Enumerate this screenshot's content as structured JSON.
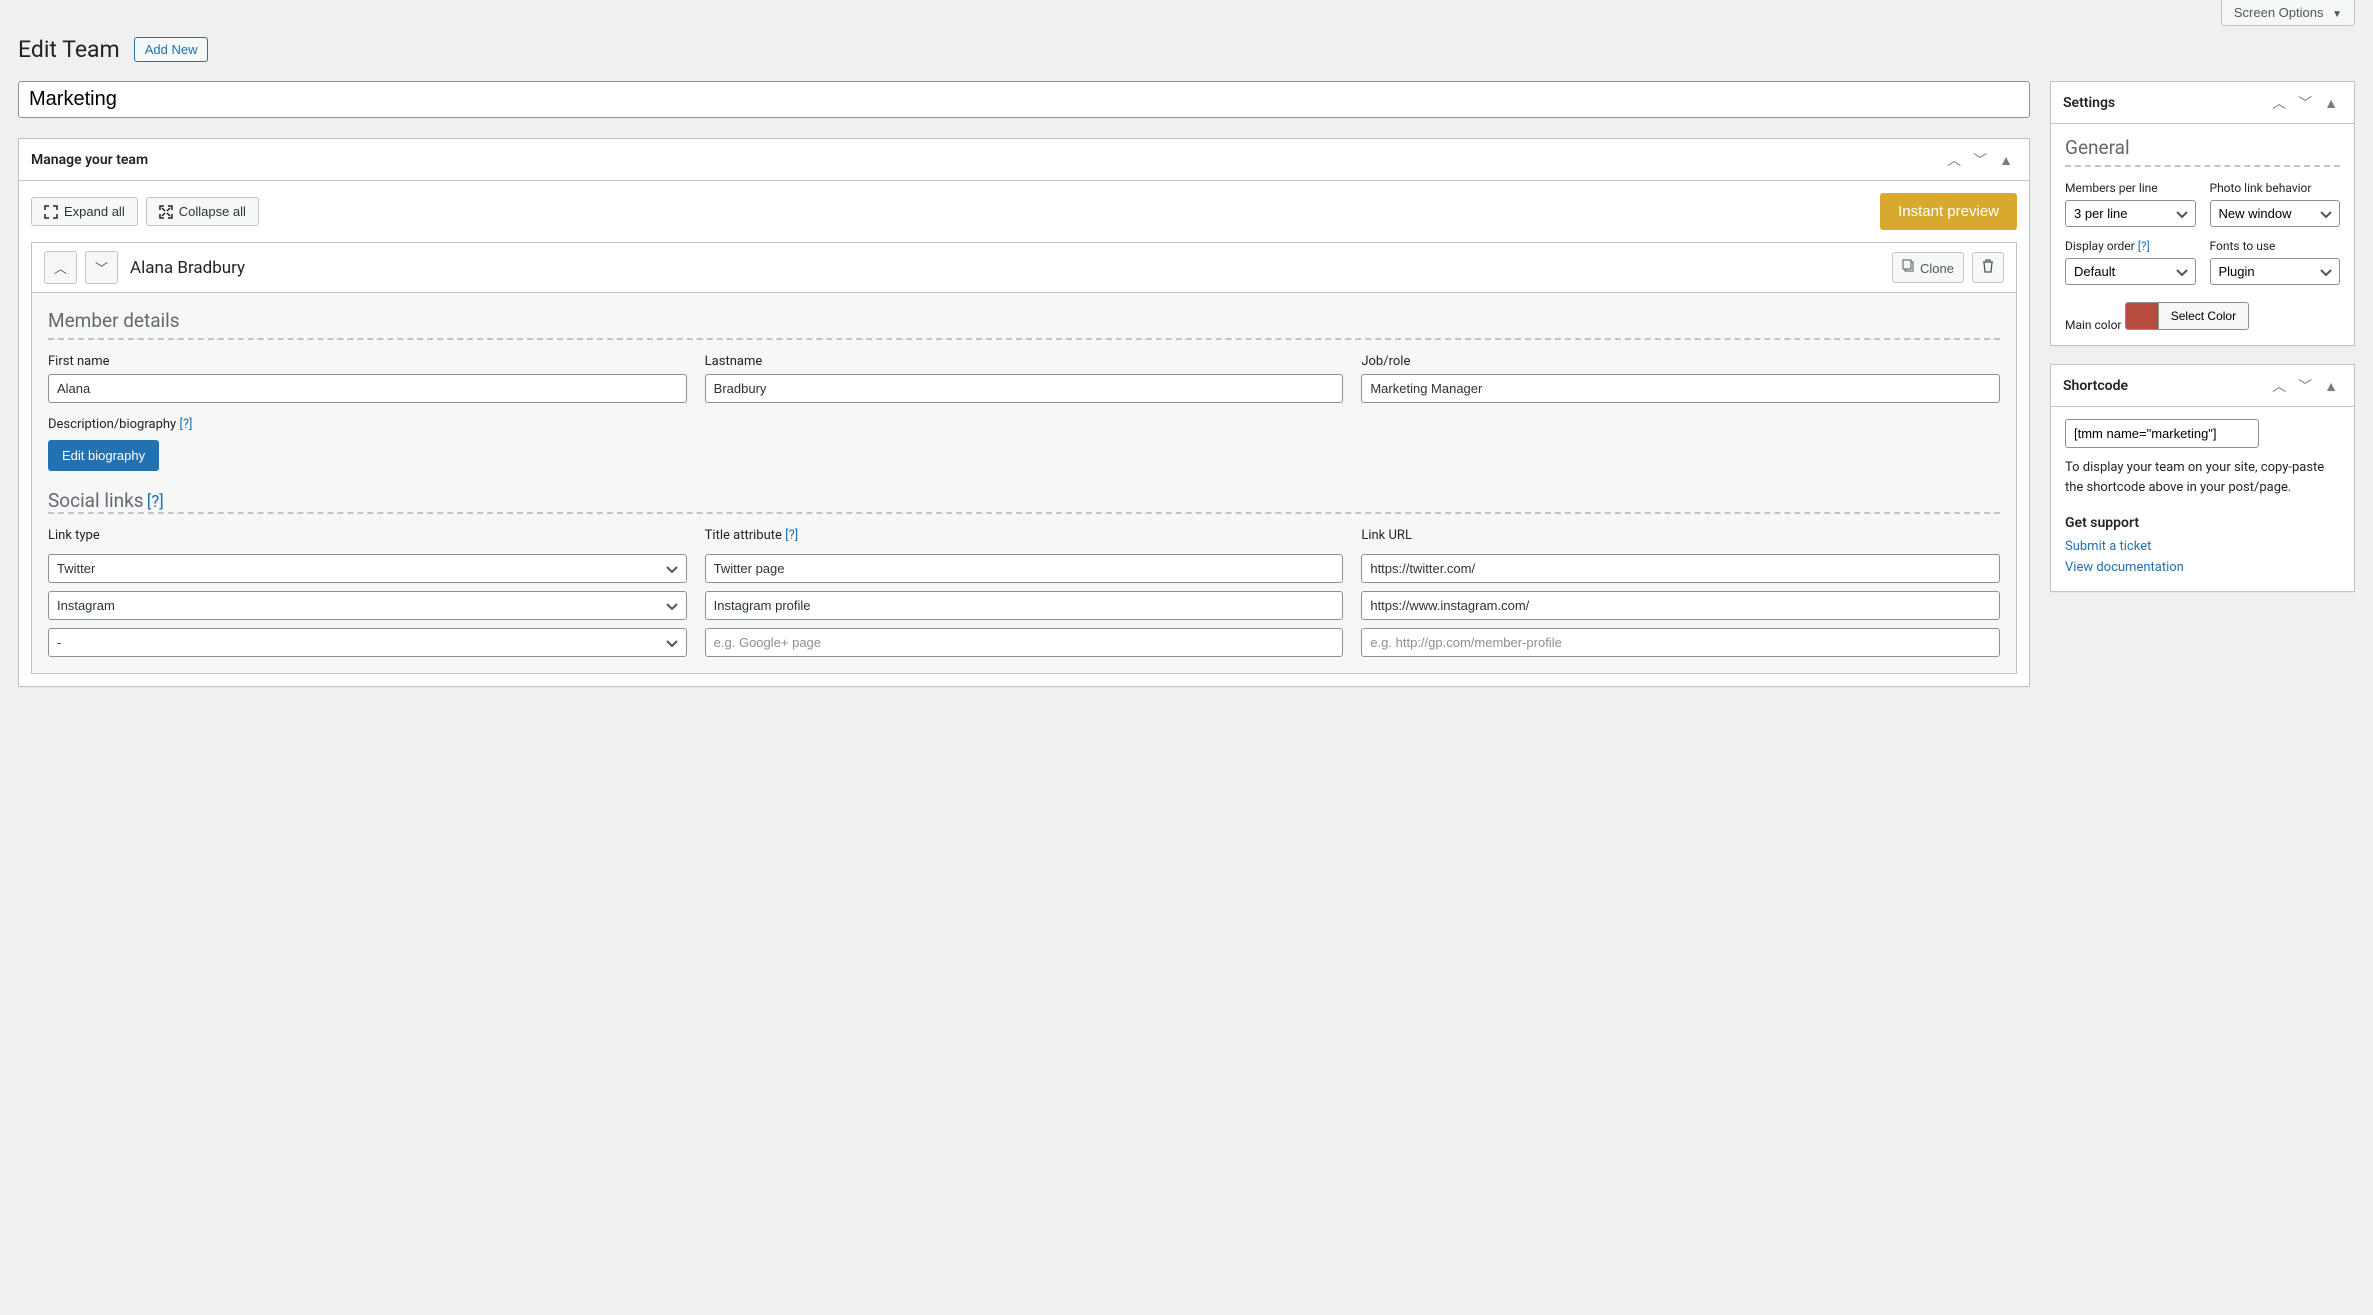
{
  "screen_options": "Screen Options",
  "page": {
    "title": "Edit Team",
    "add_new": "Add New"
  },
  "team_title": "Marketing",
  "manage": {
    "heading": "Manage your team",
    "expand_all": "Expand all",
    "collapse_all": "Collapse all",
    "instant_preview": "Instant preview"
  },
  "member": {
    "name": "Alana Bradbury",
    "clone": "Clone",
    "details_heading": "Member details",
    "first_name_label": "First name",
    "first_name": "Alana",
    "last_name_label": "Lastname",
    "last_name": "Bradbury",
    "job_label": "Job/role",
    "job": "Marketing Manager",
    "desc_label": "Description/biography",
    "desc_help": "[?]",
    "edit_bio": "Edit biography",
    "social_heading": "Social links",
    "social_help": "[?]",
    "link_type_label": "Link type",
    "title_attr_label": "Title attribute",
    "title_attr_help": "[?]",
    "link_url_label": "Link URL",
    "rows": [
      {
        "type": "Twitter",
        "title": "Twitter page",
        "url": "https://twitter.com/"
      },
      {
        "type": "Instagram",
        "title": "Instagram profile",
        "url": "https://www.instagram.com/"
      },
      {
        "type": "-",
        "title": "",
        "url": "",
        "title_ph": "e.g. Google+ page",
        "url_ph": "e.g. http://gp.com/member-profile"
      }
    ]
  },
  "settings": {
    "heading": "Settings",
    "general_heading": "General",
    "members_per_line_label": "Members per line",
    "members_per_line": "3 per line",
    "photo_link_label": "Photo link behavior",
    "photo_link": "New window",
    "display_order_label": "Display order",
    "display_order_help": "[?]",
    "display_order": "Default",
    "fonts_label": "Fonts to use",
    "fonts": "Plugin",
    "main_color_label": "Main color",
    "main_color": "#b84c3f",
    "select_color": "Select Color"
  },
  "shortcode": {
    "heading": "Shortcode",
    "code": "[tmm name=\"marketing\"]",
    "desc": "To display your team on your site, copy-paste the shortcode above in your post/page.",
    "support_heading": "Get support",
    "submit_ticket": "Submit a ticket",
    "view_docs": "View documentation"
  }
}
